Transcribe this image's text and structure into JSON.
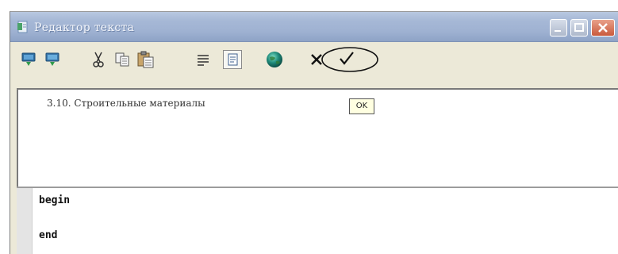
{
  "window": {
    "title": "Редактор текста"
  },
  "toolbar": {
    "buttons": [
      {
        "icon": "save-down-icon"
      },
      {
        "icon": "monitor-down-icon"
      },
      {
        "icon": "scissors-icon"
      },
      {
        "icon": "copy-icon"
      },
      {
        "icon": "paste-icon"
      },
      {
        "icon": "align-lines-icon"
      },
      {
        "icon": "page-toggle-icon"
      },
      {
        "icon": "globe-icon"
      },
      {
        "icon": "cancel-x-icon"
      },
      {
        "icon": "checkmark-icon"
      }
    ],
    "ok_tooltip": "OK"
  },
  "editor": {
    "header_text": "3.10. Строительные материалы",
    "code_lines": [
      "begin",
      "end"
    ]
  },
  "colors": {
    "titlebar": "#a6b8d6",
    "window_bg": "#ece9d8",
    "close_button": "#c95a3d",
    "globe": "#1f8a7a",
    "tooltip_bg": "#ffffe1"
  }
}
